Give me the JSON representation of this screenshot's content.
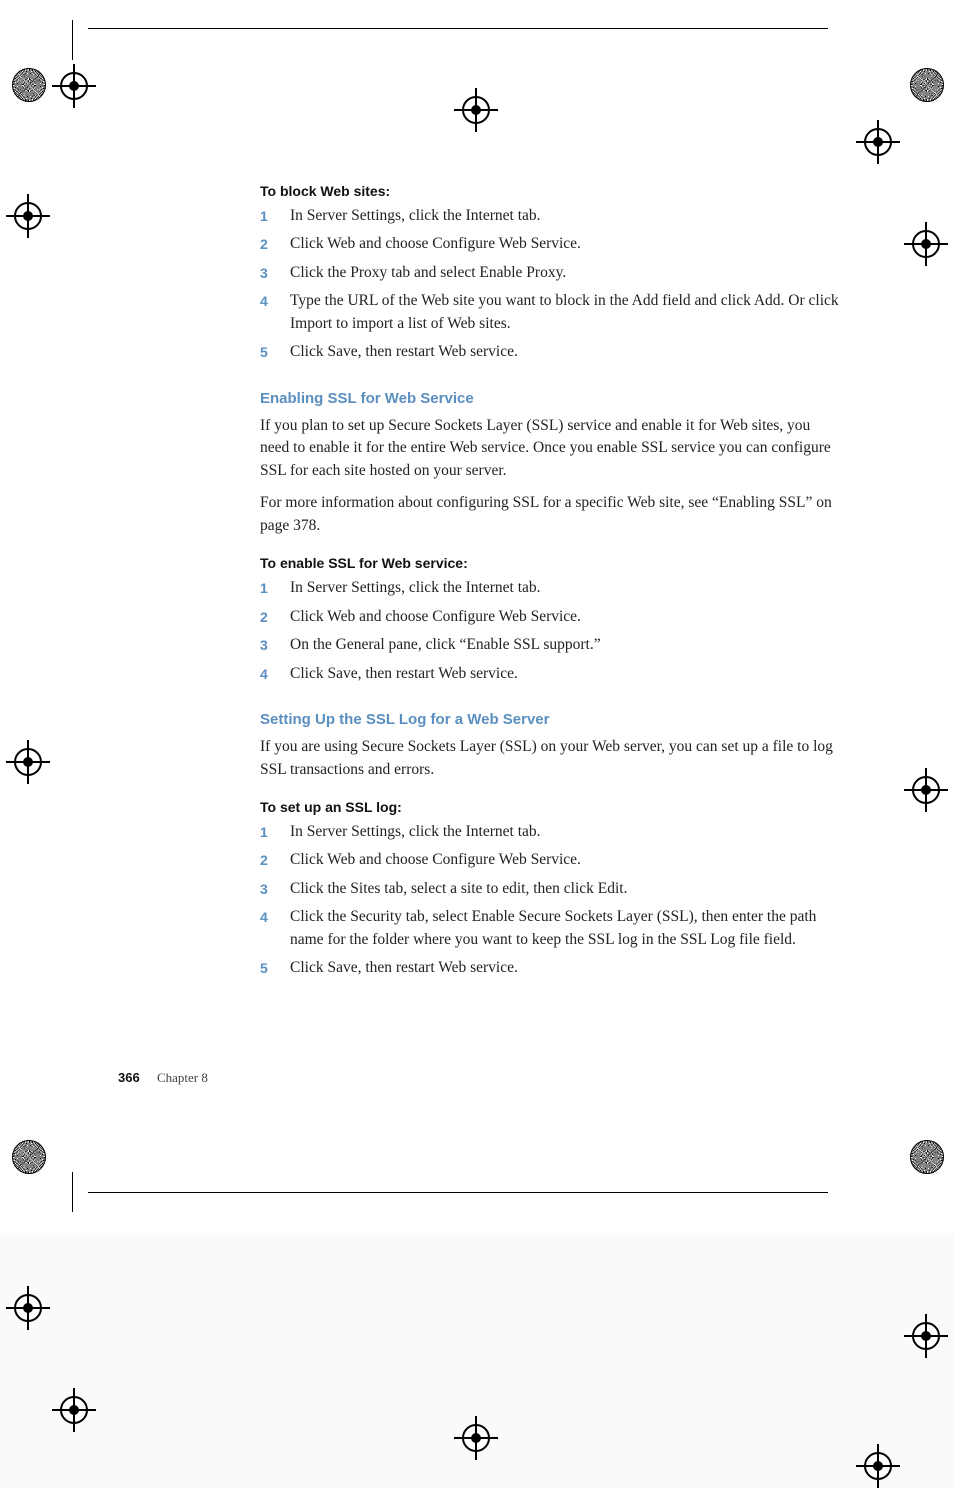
{
  "footer": {
    "pageNumber": "366",
    "chapter": "Chapter 8"
  },
  "sections": [
    {
      "procTitle": "To block Web sites:",
      "steps": [
        "In Server Settings, click the Internet tab.",
        "Click Web and choose Configure Web Service.",
        "Click the Proxy tab and select Enable Proxy.",
        "Type the URL of the Web site you want to block in the Add field and click Add. Or click Import to import a list of Web sites.",
        "Click Save, then restart Web service."
      ]
    },
    {
      "heading": "Enabling SSL for Web Service",
      "paragraphs": [
        "If you plan to set up Secure Sockets Layer (SSL) service and enable it for Web sites, you need to enable it for the entire Web service. Once you enable SSL service you can configure SSL for each site hosted on your server.",
        "For more information about configuring SSL for a specific Web site, see “Enabling SSL” on page 378."
      ],
      "procTitle": "To enable SSL for Web service:",
      "steps": [
        "In Server Settings, click the Internet tab.",
        "Click Web and choose Configure Web Service.",
        "On the General pane, click “Enable SSL support.”",
        "Click Save, then restart Web service."
      ]
    },
    {
      "heading": "Setting Up the SSL Log for a Web Server",
      "paragraphs": [
        "If you are using Secure Sockets Layer (SSL) on your Web server, you can set up a file to log SSL transactions and errors."
      ],
      "procTitle": "To set up an SSL log:",
      "steps": [
        "In Server Settings, click the Internet tab.",
        "Click Web and choose Configure Web Service.",
        "Click the Sites tab, select a site to edit, then click Edit.",
        "Click the Security tab, select Enable Secure Sockets Layer (SSL), then enter the path name for the folder where you want to keep the SSL log in the SSL Log file field.",
        "Click Save, then restart Web service."
      ]
    }
  ]
}
